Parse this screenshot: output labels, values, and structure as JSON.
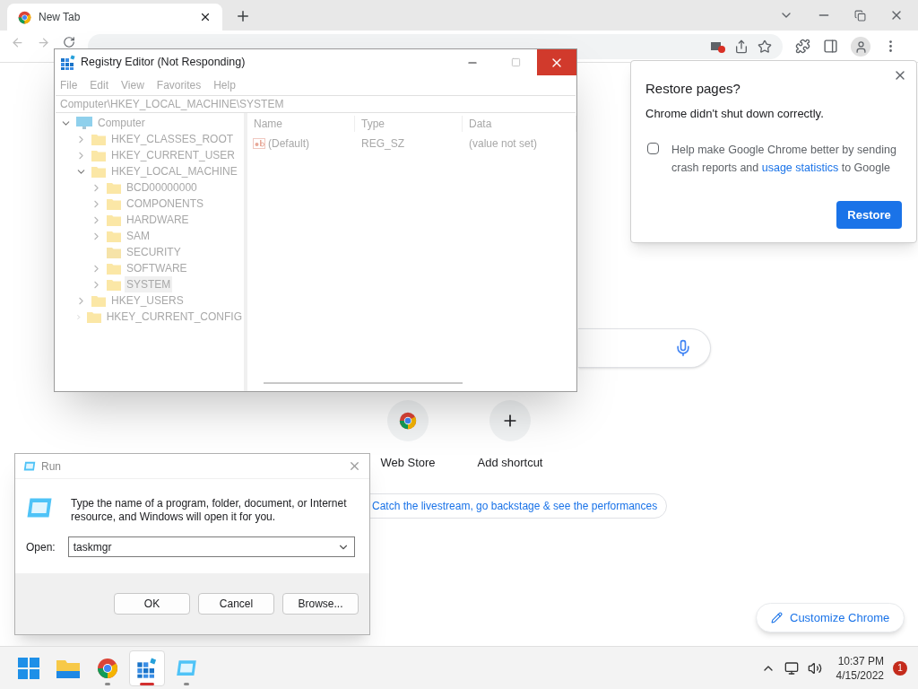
{
  "browser": {
    "tab": {
      "title": "New Tab",
      "selected": true
    },
    "shortcuts": [
      {
        "label": "Web Store",
        "kind": "store"
      },
      {
        "label": "Add shortcut",
        "kind": "add"
      }
    ],
    "promo_chip": "Catch the livestream, go backstage & see the performances",
    "customize_button": "Customize Chrome"
  },
  "restore_popup": {
    "title": "Restore pages?",
    "message": "Chrome didn't shut down correctly.",
    "consent": {
      "text_before": "Help make Google Chrome better by sending crash reports and ",
      "link": "usage statistics",
      "text_after": " to Google",
      "checked": false
    },
    "button": "Restore"
  },
  "registry_editor": {
    "title": "Registry Editor (Not Responding)",
    "menu": [
      "File",
      "Edit",
      "View",
      "Favorites",
      "Help"
    ],
    "address": "Computer\\HKEY_LOCAL_MACHINE\\SYSTEM",
    "tree": [
      {
        "label": "Computer",
        "kind": "computer",
        "expanded": true,
        "selected": false,
        "children": [
          {
            "label": "HKEY_CLASSES_ROOT",
            "kind": "branch",
            "expanded": false,
            "selected": false
          },
          {
            "label": "HKEY_CURRENT_USER",
            "kind": "branch",
            "expanded": false,
            "selected": false
          },
          {
            "label": "HKEY_LOCAL_MACHINE",
            "kind": "branch",
            "expanded": true,
            "selected": false,
            "children": [
              {
                "label": "BCD00000000",
                "kind": "branch",
                "expanded": false,
                "selected": false
              },
              {
                "label": "COMPONENTS",
                "kind": "branch",
                "expanded": false,
                "selected": false
              },
              {
                "label": "HARDWARE",
                "kind": "branch",
                "expanded": false,
                "selected": false
              },
              {
                "label": "SAM",
                "kind": "branch",
                "expanded": false,
                "selected": false
              },
              {
                "label": "SECURITY",
                "kind": "leaf",
                "selected": false
              },
              {
                "label": "SOFTWARE",
                "kind": "branch",
                "expanded": false,
                "selected": false
              },
              {
                "label": "SYSTEM",
                "kind": "branch",
                "expanded": false,
                "selected": true
              }
            ]
          },
          {
            "label": "HKEY_USERS",
            "kind": "branch",
            "expanded": false,
            "selected": false
          },
          {
            "label": "HKEY_CURRENT_CONFIG",
            "kind": "branch",
            "expanded": false,
            "selected": false
          }
        ]
      }
    ],
    "columns": [
      "Name",
      "Type",
      "Data"
    ],
    "rows": [
      {
        "name": "(Default)",
        "type": "REG_SZ",
        "data": "(value not set)"
      }
    ]
  },
  "run_dialog": {
    "title": "Run",
    "message": "Type the name of a program, folder, document, or Internet resource, and Windows will open it for you.",
    "open_label": "Open:",
    "value": "taskmgr",
    "buttons": [
      "OK",
      "Cancel",
      "Browse..."
    ]
  },
  "taskbar": {
    "apps": [
      {
        "kind": "start",
        "running": false,
        "active": false
      },
      {
        "kind": "files",
        "running": false,
        "active": false
      },
      {
        "kind": "chrome",
        "running": true,
        "active": false
      },
      {
        "kind": "regedit",
        "running": true,
        "active": true
      },
      {
        "kind": "run",
        "running": true,
        "active": false
      }
    ],
    "time": "10:37 PM",
    "date": "4/15/2022",
    "notifications": "1"
  }
}
